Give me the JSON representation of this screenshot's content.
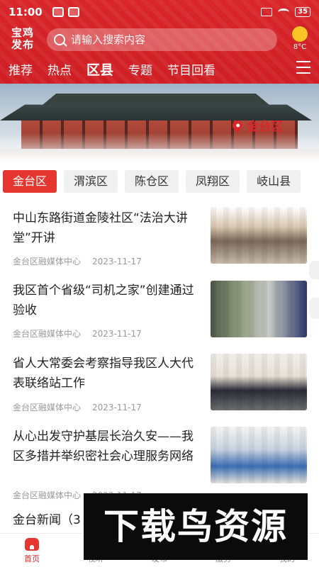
{
  "status": {
    "time": "11:00",
    "battery": "35"
  },
  "header": {
    "logo": "宝鸡发布",
    "search_placeholder": "请输入搜索内容",
    "weather_temp": "8°C",
    "tabs": [
      "推荐",
      "热点",
      "区县",
      "专题",
      "节目回看"
    ],
    "active_tab": "区县"
  },
  "banner": {
    "location": "金台区"
  },
  "districts": [
    "金台区",
    "渭滨区",
    "陈仓区",
    "凤翔区",
    "岐山县"
  ],
  "articles": [
    {
      "title": "中山东路街道金陵社区“法治大讲堂”开讲",
      "source": "金台区融媒体中心",
      "date": "2023-11-17"
    },
    {
      "title": "我区首个省级“司机之家”创建通过验收",
      "source": "金台区融媒体中心",
      "date": "2023-11-17"
    },
    {
      "title": "省人大常委会考察指导我区人大代表联络站工作",
      "source": "金台区融媒体中心",
      "date": "2023-11-17"
    },
    {
      "title": "从心出发守护基层长治久安——我区多措并举织密社会心理服务网络",
      "source": "金台区融媒体中心",
      "date": "2023-11-17"
    },
    {
      "title": "金台新闻（3",
      "source": "",
      "date": ""
    }
  ],
  "bottom_tabs": [
    "首页",
    "视听",
    "发布",
    "服务",
    "我的"
  ],
  "watermark": "下载鸟资源",
  "colors": {
    "brand_red": "#d8262a",
    "active_chip": "#e53730"
  }
}
